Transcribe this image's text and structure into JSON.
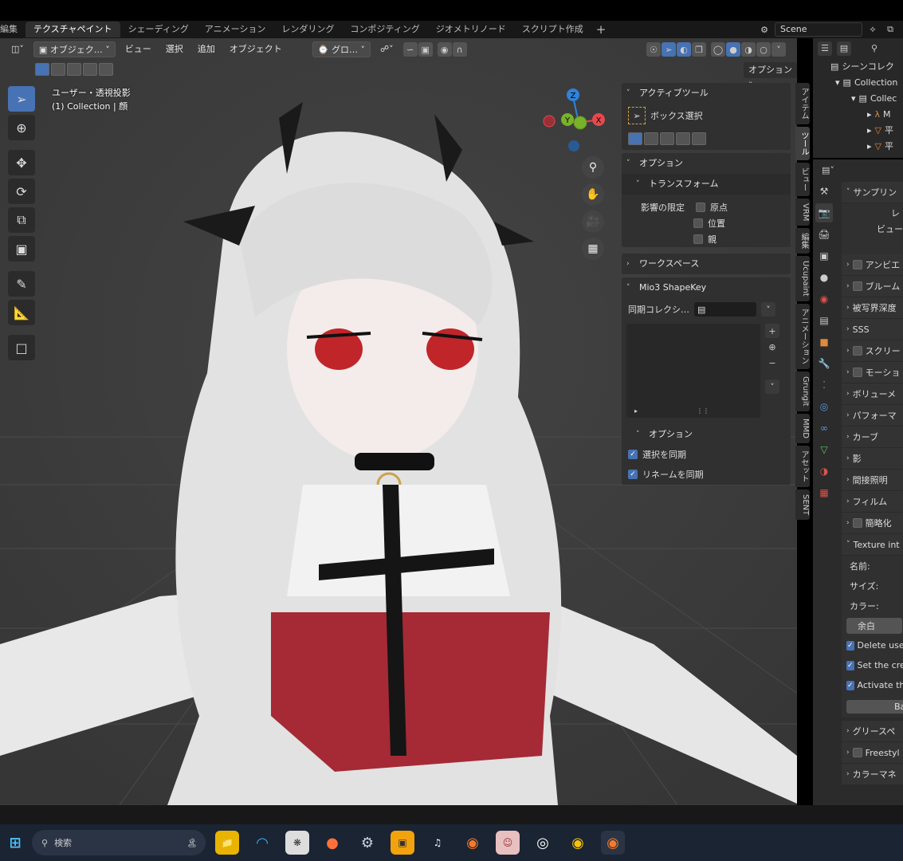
{
  "workspaces": {
    "items": [
      {
        "label": "編集",
        "active": false
      },
      {
        "label": "テクスチャペイント",
        "active": true
      },
      {
        "label": "シェーディング",
        "active": false
      },
      {
        "label": "アニメーション",
        "active": false
      },
      {
        "label": "レンダリング",
        "active": false
      },
      {
        "label": "コンポジティング",
        "active": false
      },
      {
        "label": "ジオメトリノード",
        "active": false
      },
      {
        "label": "スクリプト作成",
        "active": false
      }
    ],
    "plus": "+"
  },
  "scene": {
    "name": "Scene"
  },
  "viewport_header": {
    "mode_label": "オブジェク…",
    "menus": [
      "ビュー",
      "選択",
      "追加",
      "オブジェクト"
    ],
    "transform_label": "グロ…",
    "option_label": "オプション"
  },
  "viewport_info": {
    "line1": "ユーザー・透視投影",
    "line2": "(1) Collection | 顔"
  },
  "gizmo": {
    "z": "Z",
    "y": "Y",
    "x": "X"
  },
  "npanel": {
    "active_tool": {
      "title": "アクティブツール",
      "tool_name": "ボックス選択"
    },
    "options": {
      "title": "オプション",
      "transform_title": "トランスフォーム",
      "affect_label": "影響の限定",
      "checks": [
        {
          "label": "原点",
          "checked": false
        },
        {
          "label": "位置",
          "checked": false
        },
        {
          "label": "親",
          "checked": false
        }
      ]
    },
    "workspace": {
      "title": "ワークスペース"
    },
    "mio3": {
      "title": "Mio3 ShapeKey",
      "sync_label": "同期コレクシ…",
      "sub_title": "オプション",
      "checks": [
        {
          "label": "選択を同期",
          "checked": true
        },
        {
          "label": "リネームを同期",
          "checked": true
        }
      ]
    }
  },
  "ntabs": [
    "アイテム",
    "ツール",
    "ビュー",
    "VRM",
    "編集",
    "Ucupaint",
    "アニメーション",
    "Grungit",
    "MMD",
    "アセット",
    "SENT"
  ],
  "outliner": {
    "root": "シーンコレク",
    "items": [
      "Collection",
      "Collec",
      "M",
      "平",
      "平"
    ]
  },
  "properties": {
    "rows": [
      {
        "label": "サンプリン",
        "type": "open"
      },
      {
        "label": "レ",
        "type": "text"
      },
      {
        "label": "ビュー",
        "type": "text"
      },
      {
        "label": "アンビエ",
        "type": "check"
      },
      {
        "label": "ブルーム",
        "type": "check"
      },
      {
        "label": "被写界深度",
        "type": "closed"
      },
      {
        "label": "SSS",
        "type": "closed"
      },
      {
        "label": "スクリー",
        "type": "check"
      },
      {
        "label": "モーショ",
        "type": "check"
      },
      {
        "label": "ボリューメ",
        "type": "closed"
      },
      {
        "label": "パフォーマ",
        "type": "closed"
      },
      {
        "label": "カーブ",
        "type": "closed"
      },
      {
        "label": "影",
        "type": "closed"
      },
      {
        "label": "間接照明",
        "type": "closed"
      },
      {
        "label": "フィルム",
        "type": "closed"
      },
      {
        "label": "簡略化",
        "type": "check"
      },
      {
        "label": "Texture int",
        "type": "open"
      },
      {
        "label": "名前:",
        "type": "text"
      },
      {
        "label": "サイズ:",
        "type": "text"
      },
      {
        "label": "カラー:",
        "type": "text"
      },
      {
        "label": "余白",
        "type": "button"
      },
      {
        "label": "Delete use",
        "type": "checked"
      },
      {
        "label": "Set the cre",
        "type": "checked"
      },
      {
        "label": "Activate th",
        "type": "checked"
      },
      {
        "label": "Ba",
        "type": "button"
      },
      {
        "label": "グリースペ",
        "type": "closed"
      },
      {
        "label": "Freestyl",
        "type": "check"
      },
      {
        "label": "カラーマネ",
        "type": "closed"
      }
    ]
  },
  "taskbar": {
    "search_placeholder": "検索"
  },
  "colors": {
    "accent": "#4772b3",
    "viewport_bg": "#3d3d3d",
    "panel_bg": "#303030",
    "gizmo_x": "#e8484c",
    "gizmo_y": "#78b22a",
    "gizmo_z": "#2f83d9"
  }
}
